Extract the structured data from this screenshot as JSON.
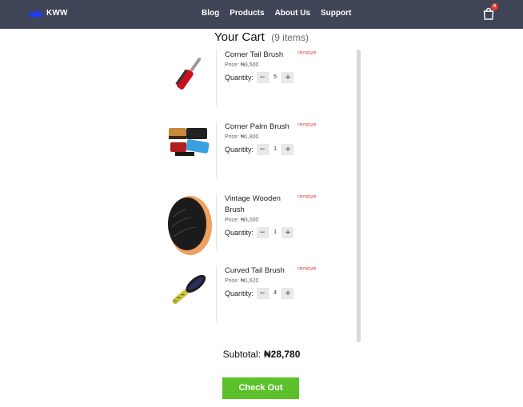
{
  "header": {
    "logo_text": "KWW",
    "nav": [
      "Blog",
      "Products",
      "About Us",
      "Support"
    ],
    "cart_count": "9"
  },
  "cart": {
    "title": "Your Cart",
    "count_text": "(9 items)",
    "qty_label": "Quantity:",
    "remove_label": "remove",
    "items": [
      {
        "name": "Corner Tail Brush",
        "price": "Price: ₦3,500",
        "qty": "5",
        "icon": "red-tail-brush-image"
      },
      {
        "name": "Corner Palm Brush",
        "price": "Price: ₦1,800",
        "qty": "1",
        "icon": "palm-brush-image"
      },
      {
        "name": "Vintage Wooden Brush",
        "price": "Price: ₦3,000",
        "qty": "1",
        "icon": "oval-wooden-brush-image"
      },
      {
        "name": "Curved Tail Brush",
        "price": "Price: ₦1,620",
        "qty": "4",
        "icon": "curved-tail-brush-image"
      }
    ],
    "subtotal_label": "Subtotal:",
    "subtotal_value": "₦28,780",
    "checkout_label": "Check Out"
  },
  "colors": {
    "nav_bg": "#3f4556",
    "checkout_bg": "#5bc02a",
    "remove": "#d9534f",
    "badge": "#e53935",
    "crown": "#1e3cff"
  }
}
